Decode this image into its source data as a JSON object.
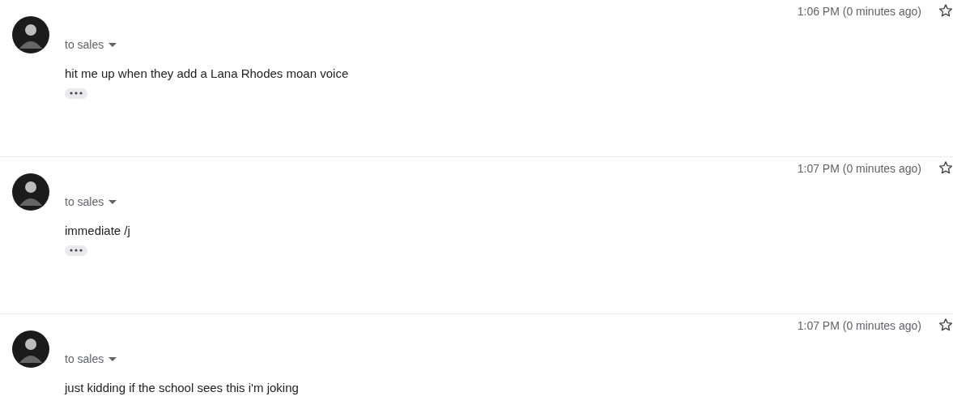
{
  "messages": [
    {
      "recipient": "to sales",
      "time": "1:06 PM (0 minutes ago)",
      "starred": false,
      "body": "hit me up when they add a Lana Rhodes moan voice",
      "show_trimmed": true
    },
    {
      "recipient": "to sales",
      "time": "1:07 PM (0 minutes ago)",
      "starred": false,
      "body": "immediate /j",
      "show_trimmed": true
    },
    {
      "recipient": "to sales",
      "time": "1:07 PM (0 minutes ago)",
      "starred": false,
      "body": "just kidding if the school sees this i'm joking",
      "show_trimmed": false
    }
  ]
}
